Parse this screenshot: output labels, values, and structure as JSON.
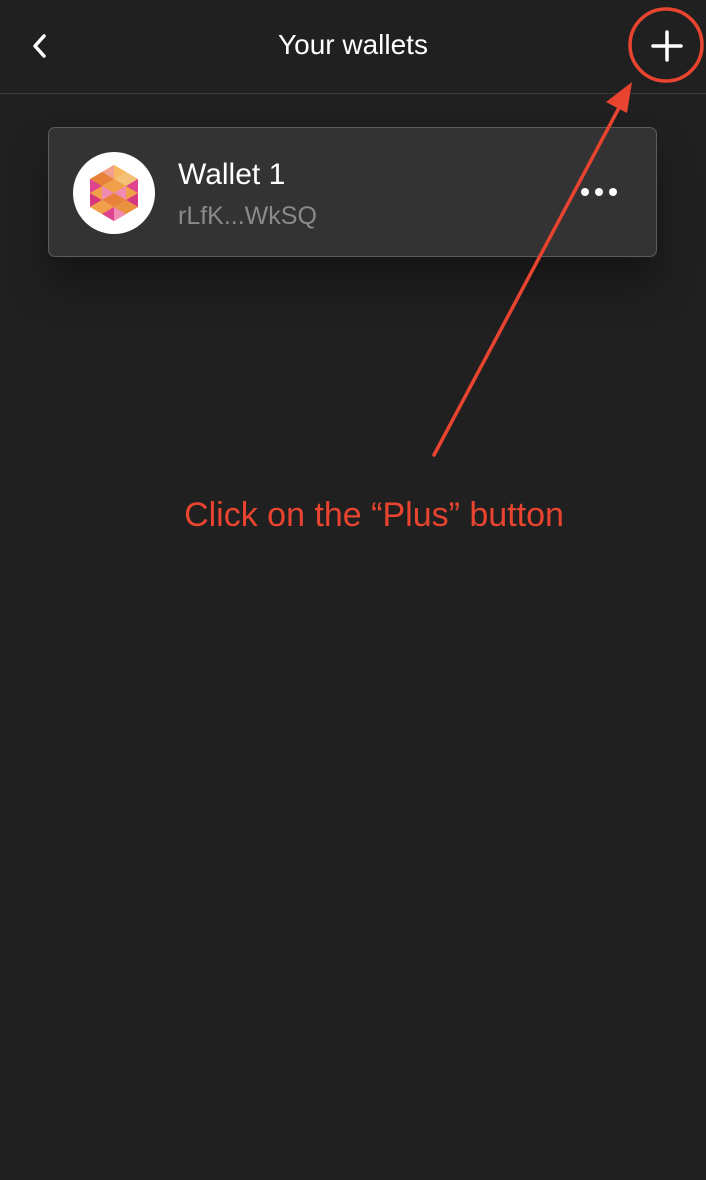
{
  "header": {
    "back_icon": "chevron-left-icon",
    "title": "Your wallets",
    "add_icon": "plus-icon"
  },
  "wallets": [
    {
      "name": "Wallet 1",
      "address": "rLfK...WkSQ",
      "avatar_icon": "hexagon-identicon",
      "menu_icon": "more-horizontal-icon"
    }
  ],
  "annotation": {
    "text": "Click on the “Plus” button",
    "color": "#e8442f"
  },
  "colors": {
    "background": "#202020",
    "card": "#333333",
    "text": "#ffffff",
    "muted_text": "#8a8a8a",
    "accent": "#e8442f"
  }
}
